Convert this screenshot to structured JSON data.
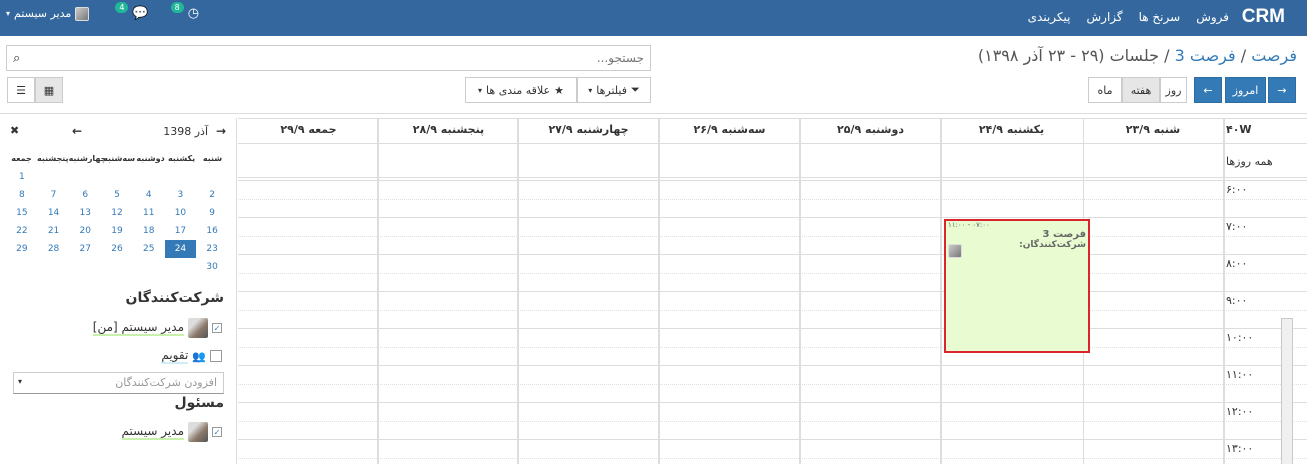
{
  "navbar": {
    "brand": "CRM",
    "menu": [
      "فروش",
      "سرنخ ها",
      "گزارش",
      "پیکربندی"
    ],
    "activity_count": "8",
    "message_count": "4",
    "user_name": "مدیر سیستم"
  },
  "breadcrumb": {
    "link1": "فرصت",
    "link2": "فرصت 3",
    "current": "جلسات (۲۹ - ۲۳ آذر ۱۳۹۸)"
  },
  "search": {
    "placeholder": "جستجو..."
  },
  "toolbar": {
    "today": "امروز",
    "day": "روز",
    "week": "هفته",
    "month": "ماه",
    "filters": "فیلترها",
    "favorites": "علاقه مندی ها"
  },
  "mini_calendar": {
    "month_label": "آذر 1398",
    "weekdays": [
      "شنبه",
      "یکشنبه",
      "دوشنبه",
      "سه‌شنبه",
      "چهارشنبه",
      "پنجشنبه",
      "جمعه"
    ],
    "weeks": [
      [
        "",
        "",
        "",
        "",
        "",
        "",
        "1"
      ],
      [
        "2",
        "3",
        "4",
        "5",
        "6",
        "7",
        "8"
      ],
      [
        "9",
        "10",
        "11",
        "12",
        "13",
        "14",
        "15"
      ],
      [
        "16",
        "17",
        "18",
        "19",
        "20",
        "21",
        "22"
      ],
      [
        "23",
        "24",
        "25",
        "26",
        "27",
        "28",
        "29"
      ],
      [
        "30",
        "",
        "",
        "",
        "",
        "",
        ""
      ]
    ],
    "today": "24"
  },
  "sidebar": {
    "attendees_title": "شرکت‌کنندگان",
    "attendee_me": "مدیر سیستم [من]",
    "calendar_label": "تقویم",
    "add_attendee_placeholder": "افزودن شرکت‌کنندگان",
    "responsible_title": "مسئول",
    "responsible_name": "مدیر سیستم"
  },
  "calendar": {
    "week_label": "۴۰W",
    "all_day": "همه روزها",
    "days": [
      "شنبه ۲۳/۹",
      "یکشنبه ۲۴/۹",
      "دوشنبه ۲۵/۹",
      "سه‌شنبه ۲۶/۹",
      "چهارشنبه ۲۷/۹",
      "پنجشنبه ۲۸/۹",
      "جمعه ۲۹/۹"
    ],
    "times": [
      "۶:۰۰",
      "۷:۰۰",
      "۸:۰۰",
      "۹:۰۰",
      "۱۰:۰۰",
      "۱۱:۰۰",
      "۱۲:۰۰",
      "۱۳:۰۰"
    ],
    "event": {
      "time": "۰۷:۰۰ - ۱۱:۰۰",
      "title": "فرصت 3",
      "attendees_label": "شرکت‌کنندگان:"
    }
  }
}
